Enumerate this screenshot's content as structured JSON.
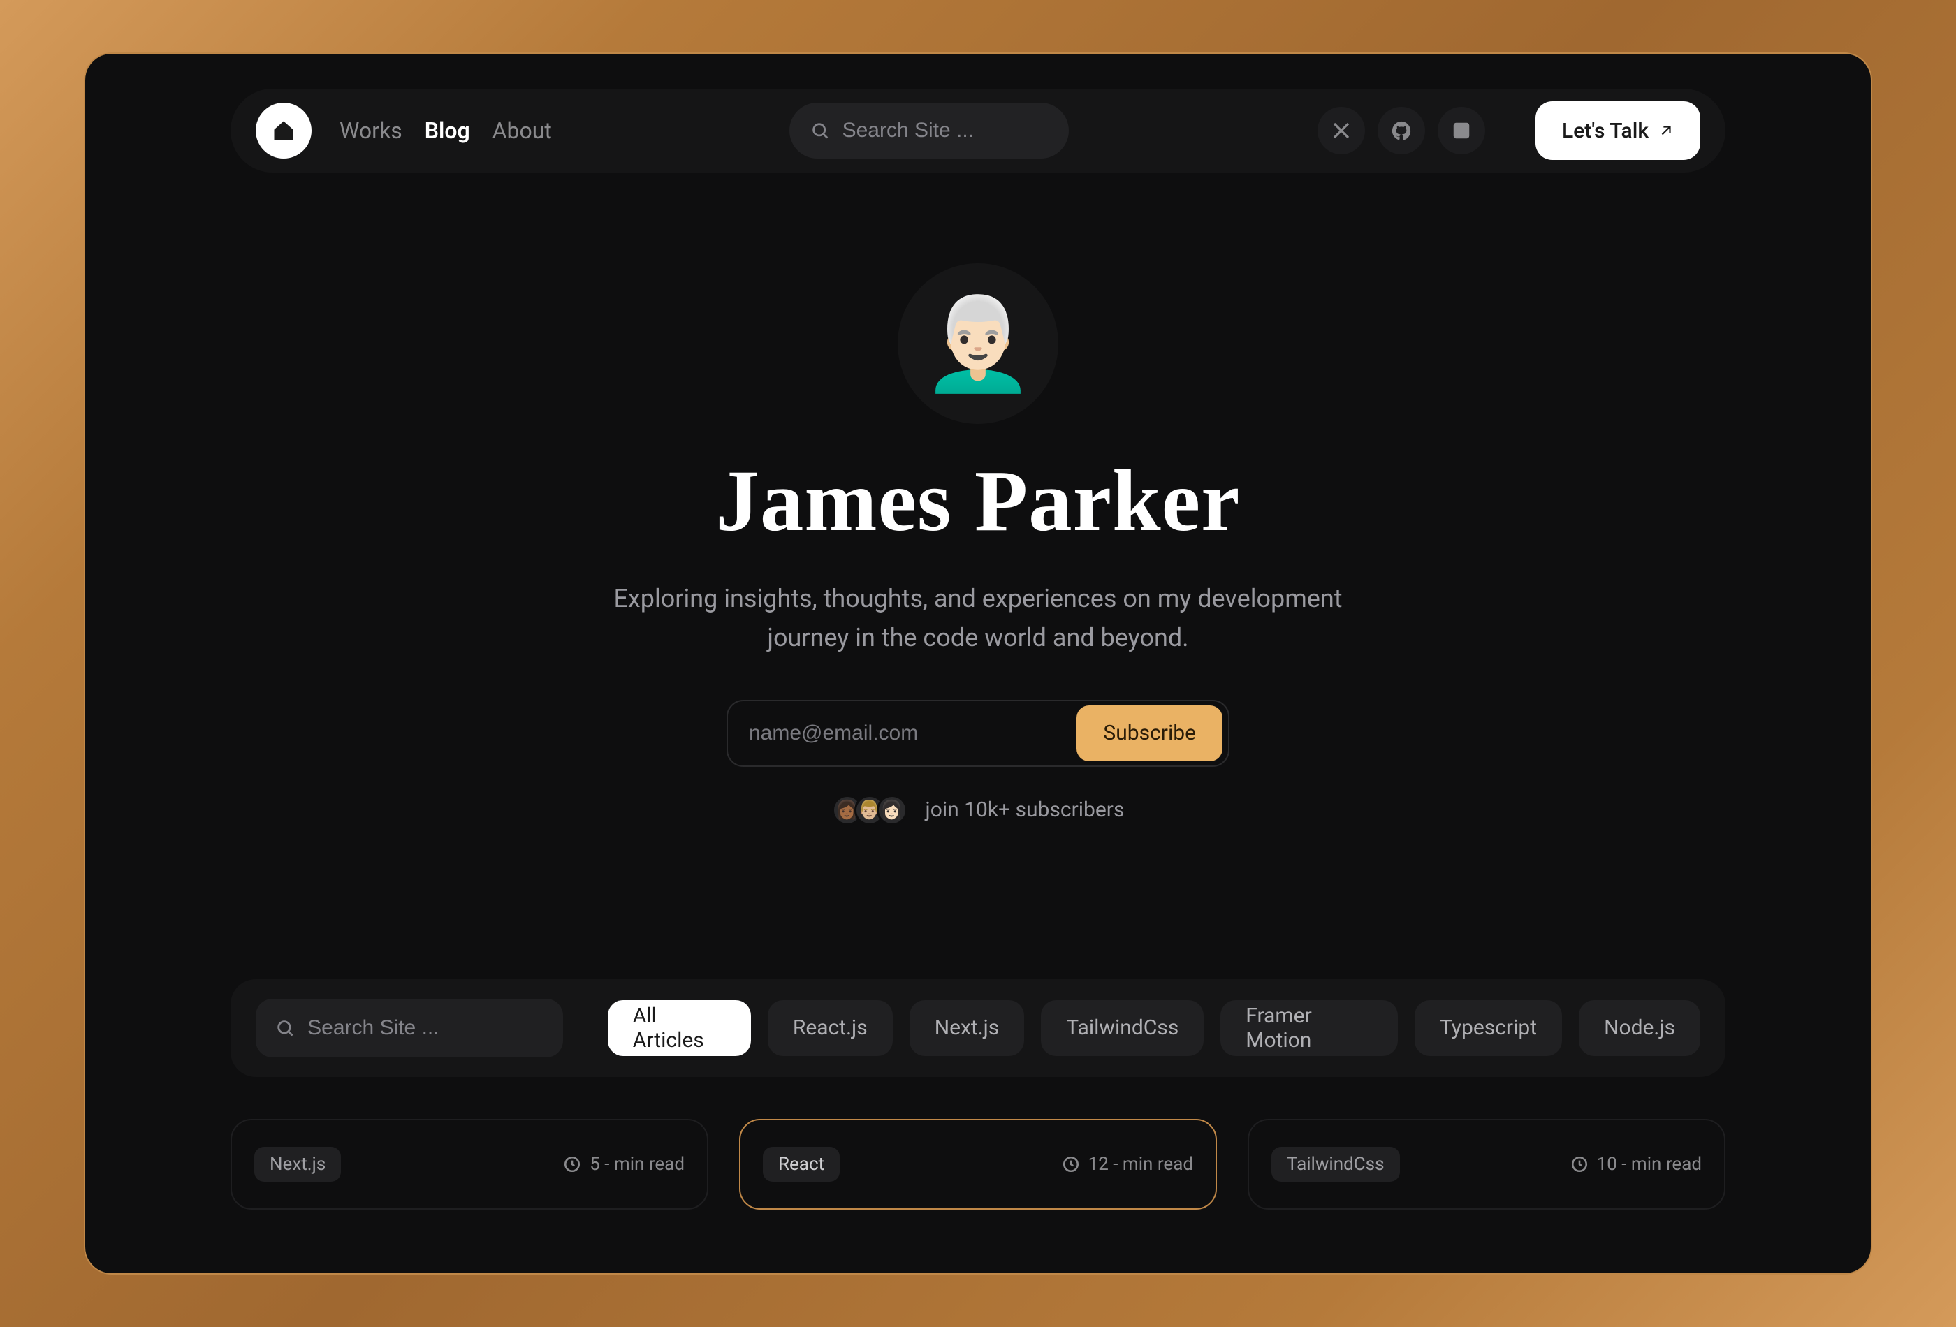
{
  "nav": {
    "links": [
      {
        "label": "Works",
        "active": false
      },
      {
        "label": "Blog",
        "active": true
      },
      {
        "label": "About",
        "active": false
      }
    ],
    "search_placeholder": "Search Site ...",
    "talk_label": "Let's Talk"
  },
  "social": {
    "items": [
      "x-icon",
      "github-icon",
      "linkedin-icon"
    ]
  },
  "hero": {
    "name": "James Parker",
    "subtitle": "Exploring insights, thoughts, and experiences on my development journey in the code world and beyond.",
    "email_placeholder": "name@email.com",
    "subscribe_label": "Subscribe",
    "join_text": "join 10k+ subscribers"
  },
  "filter": {
    "search_placeholder": "Search Site ...",
    "tags": [
      {
        "label": "All Articles",
        "active": true
      },
      {
        "label": "React.js",
        "active": false
      },
      {
        "label": "Next.js",
        "active": false
      },
      {
        "label": "TailwindCss",
        "active": false
      },
      {
        "label": "Framer Motion",
        "active": false
      },
      {
        "label": "Typescript",
        "active": false
      },
      {
        "label": "Node.js",
        "active": false
      }
    ]
  },
  "cards": [
    {
      "tag": "Next.js",
      "read": "5 - min read",
      "highlight": false
    },
    {
      "tag": "React",
      "read": "12 - min read",
      "highlight": true
    },
    {
      "tag": "TailwindCss",
      "read": "10 - min read",
      "highlight": false
    }
  ]
}
